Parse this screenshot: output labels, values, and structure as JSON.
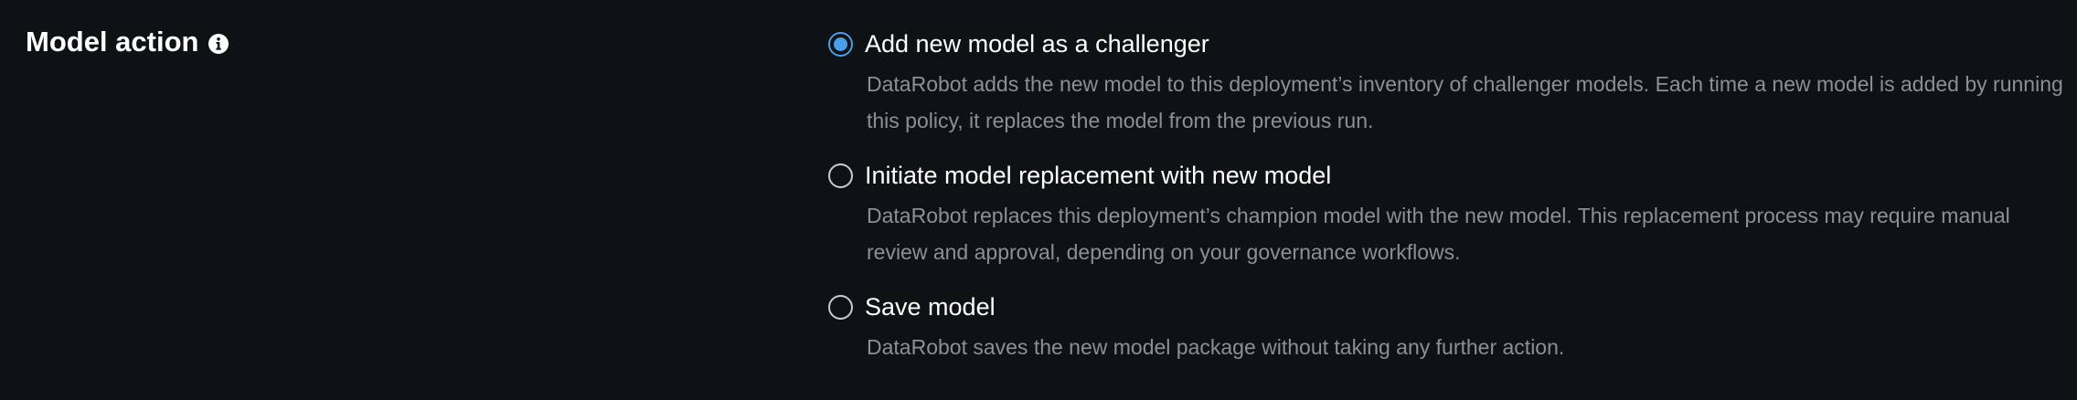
{
  "section": {
    "title": "Model action",
    "info_icon": "info-circle-icon"
  },
  "colors": {
    "background": "#0f1215",
    "accent": "#4a9de8",
    "label": "#ffffff",
    "description": "#8b9096"
  },
  "options": [
    {
      "label": "Add new model as a challenger",
      "description": "DataRobot adds the new model to this deployment’s inventory of challenger models. Each time a new model is added by running this policy, it replaces the model from the previous run.",
      "selected": true
    },
    {
      "label": "Initiate model replacement with new model",
      "description": "DataRobot replaces this deployment’s champion model with the new model. This replacement process may require manual review and approval, depending on your governance workflows.",
      "selected": false
    },
    {
      "label": "Save model",
      "description": "DataRobot saves the new model package without taking any further action.",
      "selected": false
    }
  ]
}
